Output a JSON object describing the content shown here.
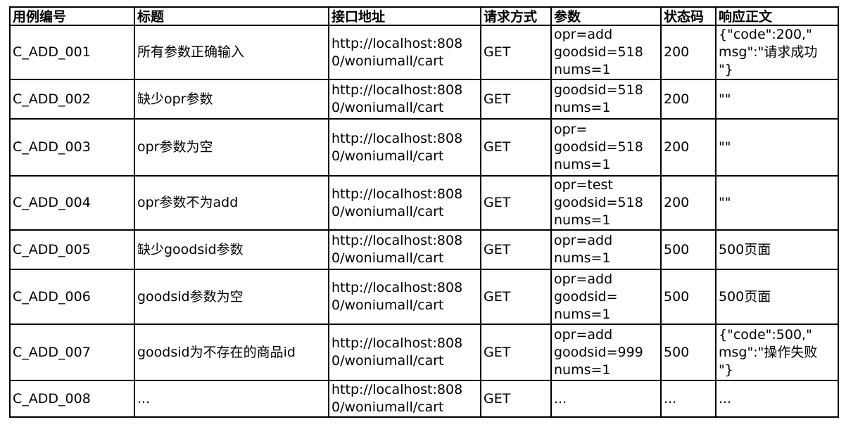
{
  "headers": [
    "用例编号",
    "标题",
    "接口地址",
    "请求方式",
    "参数",
    "状态码",
    "响应正文"
  ],
  "rows": [
    {
      "id": "C_ADD_001",
      "title": "所有参数正确输入",
      "url": [
        "http://localhost:808",
        "0/woniumall/cart"
      ],
      "method": "GET",
      "params": [
        "opr=add",
        "goodsid=518",
        "nums=1"
      ],
      "status": "200",
      "response": [
        "{\"code\":200,\"",
        "msg\":\"请求成功",
        "\"}"
      ]
    },
    {
      "id": "C_ADD_002",
      "title": "缺少opr参数",
      "url": [
        "http://localhost:808",
        "0/woniumall/cart"
      ],
      "method": "GET",
      "params": [
        "goodsid=518",
        "nums=1"
      ],
      "status": "200",
      "response": [
        "\"\""
      ]
    },
    {
      "id": "C_ADD_003",
      "title": "opr参数为空",
      "url": [
        "http://localhost:808",
        "0/woniumall/cart"
      ],
      "method": "GET",
      "params": [
        "opr=",
        "goodsid=518",
        "nums=1"
      ],
      "status": "200",
      "response": [
        "\"\""
      ]
    },
    {
      "id": "C_ADD_004",
      "title": "opr参数不为add",
      "url": [
        "http://localhost:808",
        "0/woniumall/cart"
      ],
      "method": "GET",
      "params": [
        "opr=test",
        "goodsid=518",
        "nums=1"
      ],
      "status": "200",
      "response": [
        "\"\""
      ]
    },
    {
      "id": "C_ADD_005",
      "title": "缺少goodsid参数",
      "url": [
        "http://localhost:808",
        "0/woniumall/cart"
      ],
      "method": "GET",
      "params": [
        "opr=add",
        "nums=1"
      ],
      "status": "500",
      "response": [
        "500页面"
      ]
    },
    {
      "id": "C_ADD_006",
      "title": "goodsid参数为空",
      "url": [
        "http://localhost:808",
        "0/woniumall/cart"
      ],
      "method": "GET",
      "params": [
        "opr=add",
        "goodsid=",
        "nums=1"
      ],
      "status": "500",
      "response": [
        "500页面"
      ]
    },
    {
      "id": "C_ADD_007",
      "title": "goodsid为不存在的商品id",
      "url": [
        "http://localhost:808",
        "0/woniumall/cart"
      ],
      "method": "GET",
      "params": [
        "opr=add",
        "goodsid=999",
        "nums=1"
      ],
      "status": "500",
      "response": [
        "{\"code\":500,\"",
        "msg\":\"操作失败",
        "\"}"
      ]
    },
    {
      "id": "C_ADD_008",
      "title": "...",
      "url": [
        "http://localhost:808",
        "0/woniumall/cart"
      ],
      "method": "GET",
      "params": [
        "..."
      ],
      "status": "...",
      "response": [
        "..."
      ]
    }
  ]
}
